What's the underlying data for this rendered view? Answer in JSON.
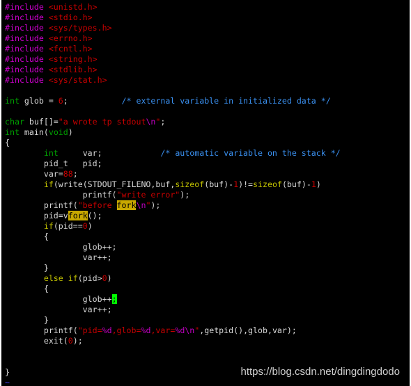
{
  "editor": {
    "colors": {
      "background": "#000000",
      "text": "#d8d8d8",
      "preprocessor": "#d000d0",
      "string": "#c80000",
      "type": "#00a000",
      "comment": "#3a90f0",
      "keyword": "#c0c000",
      "search_highlight": "#c8a800",
      "cursor": "#00ff00"
    },
    "lines": [
      [
        {
          "t": "#include",
          "c": "pp"
        },
        {
          "t": " <unistd.h>",
          "c": "inc"
        }
      ],
      [
        {
          "t": "#include",
          "c": "pp"
        },
        {
          "t": " <stdio.h>",
          "c": "inc"
        }
      ],
      [
        {
          "t": "#include",
          "c": "pp"
        },
        {
          "t": " <sys/types.h>",
          "c": "inc"
        }
      ],
      [
        {
          "t": "#include",
          "c": "pp"
        },
        {
          "t": " <errno.h>",
          "c": "inc"
        }
      ],
      [
        {
          "t": "#include",
          "c": "pp"
        },
        {
          "t": " <fcntl.h>",
          "c": "inc"
        }
      ],
      [
        {
          "t": "#include",
          "c": "pp"
        },
        {
          "t": " <string.h>",
          "c": "inc"
        }
      ],
      [
        {
          "t": "#include",
          "c": "pp"
        },
        {
          "t": " <stdlib.h>",
          "c": "inc"
        }
      ],
      [
        {
          "t": "#include",
          "c": "pp"
        },
        {
          "t": " <sys/stat.h>",
          "c": "inc"
        }
      ],
      [],
      [
        {
          "t": "int",
          "c": "ty"
        },
        {
          "t": " glob = ",
          "c": "t"
        },
        {
          "t": "6",
          "c": "num"
        },
        {
          "t": ";           ",
          "c": "t"
        },
        {
          "t": "/* external variable in initialized data */",
          "c": "cm"
        }
      ],
      [],
      [
        {
          "t": "char",
          "c": "ty"
        },
        {
          "t": " buf[]=",
          "c": "t"
        },
        {
          "t": "\"a wrote tp stdout",
          "c": "str"
        },
        {
          "t": "\\n",
          "c": "sp"
        },
        {
          "t": "\"",
          "c": "str"
        },
        {
          "t": ";",
          "c": "t"
        }
      ],
      [
        {
          "t": "int",
          "c": "ty"
        },
        {
          "t": " main(",
          "c": "t"
        },
        {
          "t": "void",
          "c": "ty"
        },
        {
          "t": ")",
          "c": "t"
        }
      ],
      [
        {
          "t": "{",
          "c": "t"
        }
      ],
      [
        {
          "t": "        ",
          "c": "t"
        },
        {
          "t": "int",
          "c": "ty"
        },
        {
          "t": "     var;            ",
          "c": "t"
        },
        {
          "t": "/* automatic variable on the stack */",
          "c": "cm"
        }
      ],
      [
        {
          "t": "        pid_t   pid;",
          "c": "t"
        }
      ],
      [
        {
          "t": "        var=",
          "c": "t"
        },
        {
          "t": "88",
          "c": "num"
        },
        {
          "t": ";",
          "c": "t"
        }
      ],
      [
        {
          "t": "        ",
          "c": "t"
        },
        {
          "t": "if",
          "c": "kw"
        },
        {
          "t": "(write(STDOUT_FILENO,buf,",
          "c": "t"
        },
        {
          "t": "sizeof",
          "c": "kw"
        },
        {
          "t": "(buf)-",
          "c": "t"
        },
        {
          "t": "1",
          "c": "num"
        },
        {
          "t": ")!=",
          "c": "t"
        },
        {
          "t": "sizeof",
          "c": "kw"
        },
        {
          "t": "(buf)-",
          "c": "t"
        },
        {
          "t": "1",
          "c": "num"
        },
        {
          "t": ")",
          "c": "t"
        }
      ],
      [
        {
          "t": "                printf(",
          "c": "t"
        },
        {
          "t": "\"write error\"",
          "c": "str"
        },
        {
          "t": ");",
          "c": "t"
        }
      ],
      [
        {
          "t": "        printf(",
          "c": "t"
        },
        {
          "t": "\"before ",
          "c": "str"
        },
        {
          "t": "fork",
          "c": "hl"
        },
        {
          "t": "\\n",
          "c": "sp"
        },
        {
          "t": "\"",
          "c": "str"
        },
        {
          "t": ");",
          "c": "t"
        }
      ],
      [
        {
          "t": "        pid=v",
          "c": "t"
        },
        {
          "t": "fork",
          "c": "hl"
        },
        {
          "t": "();",
          "c": "t"
        }
      ],
      [
        {
          "t": "        ",
          "c": "t"
        },
        {
          "t": "if",
          "c": "kw"
        },
        {
          "t": "(pid==",
          "c": "t"
        },
        {
          "t": "0",
          "c": "num"
        },
        {
          "t": ")",
          "c": "t"
        }
      ],
      [
        {
          "t": "        {",
          "c": "t"
        }
      ],
      [
        {
          "t": "                glob++;",
          "c": "t"
        }
      ],
      [
        {
          "t": "                var++;",
          "c": "t"
        }
      ],
      [
        {
          "t": "        }",
          "c": "t"
        }
      ],
      [
        {
          "t": "        ",
          "c": "t"
        },
        {
          "t": "else if",
          "c": "kw"
        },
        {
          "t": "(pid>",
          "c": "t"
        },
        {
          "t": "0",
          "c": "num"
        },
        {
          "t": ")",
          "c": "t"
        }
      ],
      [
        {
          "t": "        {",
          "c": "t"
        }
      ],
      [
        {
          "t": "                glob++",
          "c": "t"
        },
        {
          "t": ";",
          "c": "cur"
        }
      ],
      [
        {
          "t": "                var++;",
          "c": "t"
        }
      ],
      [
        {
          "t": "        }",
          "c": "t"
        }
      ],
      [
        {
          "t": "        printf(",
          "c": "t"
        },
        {
          "t": "\"pid=",
          "c": "str"
        },
        {
          "t": "%d",
          "c": "sp"
        },
        {
          "t": ",glob=",
          "c": "str"
        },
        {
          "t": "%d",
          "c": "sp"
        },
        {
          "t": ",var=",
          "c": "str"
        },
        {
          "t": "%d\\n",
          "c": "sp"
        },
        {
          "t": "\"",
          "c": "str"
        },
        {
          "t": ",getpid(),glob,var);",
          "c": "t"
        }
      ],
      [
        {
          "t": "        exit(",
          "c": "t"
        },
        {
          "t": "0",
          "c": "num"
        },
        {
          "t": ");",
          "c": "t"
        }
      ],
      [],
      [],
      [
        {
          "t": "}",
          "c": "t"
        }
      ],
      [
        {
          "t": "~",
          "c": "tilde"
        }
      ]
    ]
  },
  "watermark": "https://blog.csdn.net/dingdingdodo"
}
